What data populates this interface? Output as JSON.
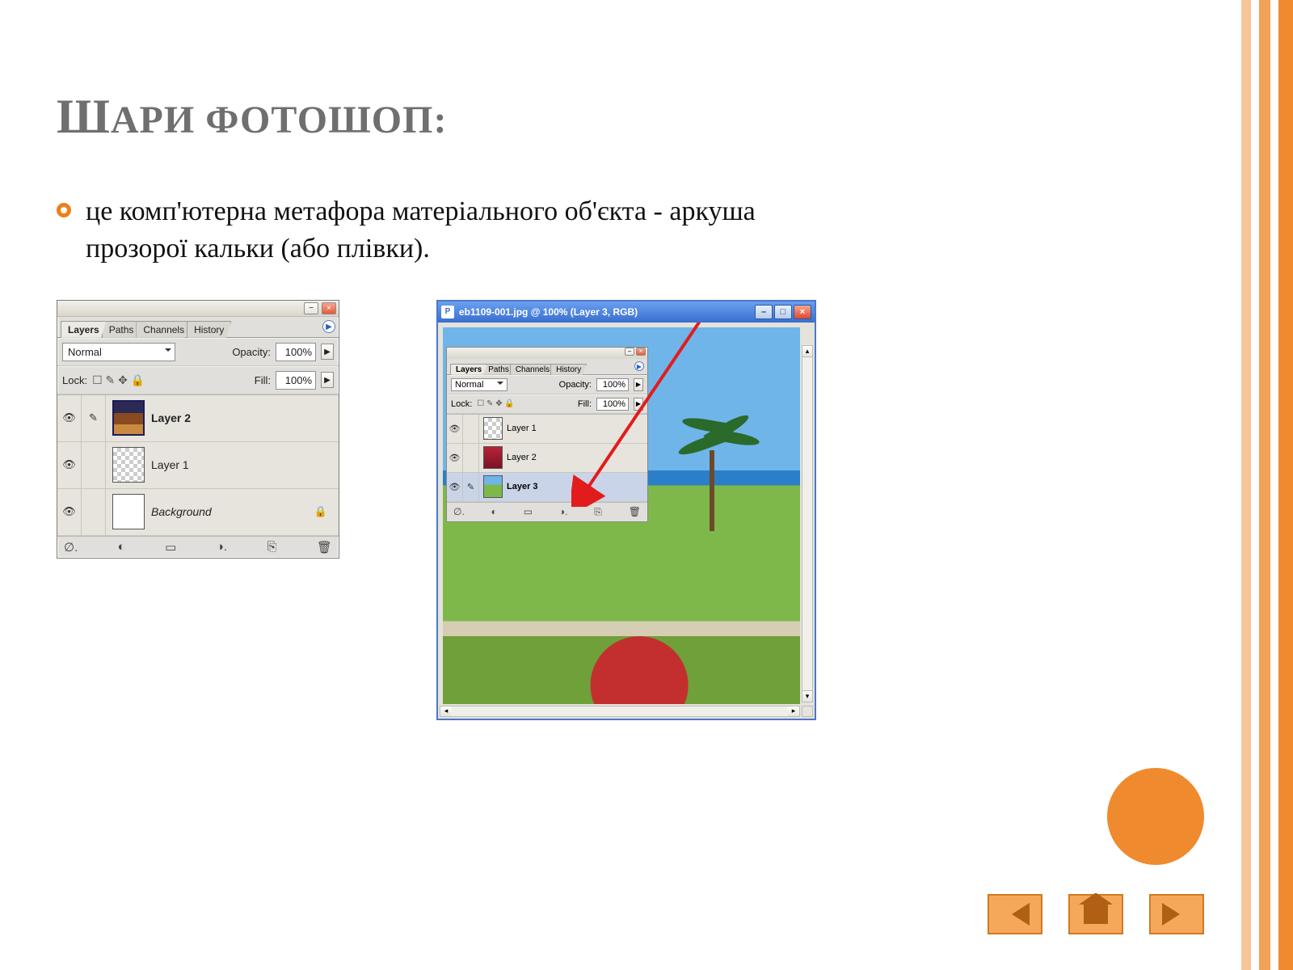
{
  "slide": {
    "title": "Шари фотошоп:",
    "bullet": "це комп'ютерна метафора матеріального об'єкта - аркуша прозорої кальки (або плівки)."
  },
  "left_panel": {
    "tabs": [
      "Layers",
      "Paths",
      "Channels",
      "History"
    ],
    "active_tab": "Layers",
    "blend_mode": "Normal",
    "opacity_label": "Opacity:",
    "opacity_value": "100%",
    "lock_label": "Lock:",
    "fill_label": "Fill:",
    "fill_value": "100%",
    "layers": [
      {
        "name": "Layer 2",
        "bold": true,
        "thumb": "photo",
        "locked": false
      },
      {
        "name": "Layer 1",
        "bold": false,
        "thumb": "checker",
        "locked": false
      },
      {
        "name": "Background",
        "italic": true,
        "thumb": "white",
        "locked": true
      }
    ]
  },
  "right_window": {
    "title": "eb1109-001.jpg @ 100% (Layer 3, RGB)",
    "mini_panel": {
      "tabs": [
        "Layers",
        "Paths",
        "Channels",
        "History"
      ],
      "blend_mode": "Normal",
      "opacity_label": "Opacity:",
      "opacity_value": "100%",
      "lock_label": "Lock:",
      "fill_label": "Fill:",
      "fill_value": "100%",
      "layers": [
        {
          "name": "Layer 1",
          "selected": false
        },
        {
          "name": "Layer 2",
          "selected": false
        },
        {
          "name": "Layer 3",
          "selected": true
        }
      ]
    }
  },
  "nav": {
    "prev": "previous",
    "home": "home",
    "next": "next"
  }
}
